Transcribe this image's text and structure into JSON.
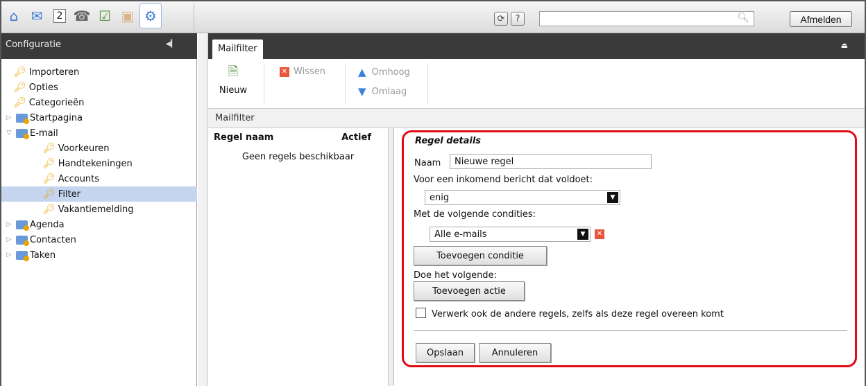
{
  "topbar": {
    "apps": [
      {
        "icon": "home-icon",
        "glyph": "⌂"
      },
      {
        "icon": "mail-icon",
        "glyph": "✉"
      },
      {
        "icon": "calendar-icon",
        "glyph": "2"
      },
      {
        "icon": "contacts-icon",
        "glyph": "☎"
      },
      {
        "icon": "tasks-icon",
        "glyph": "☑"
      },
      {
        "icon": "briefcase-icon",
        "glyph": "▣"
      },
      {
        "icon": "settings-icon",
        "glyph": "⚙"
      }
    ],
    "refresh_glyph": "⟳",
    "help_glyph": "?",
    "search": {
      "placeholder": "",
      "value": ""
    },
    "logout_label": "Afmelden"
  },
  "left": {
    "title": "Configuratie",
    "tree": [
      {
        "label": "Importeren",
        "type": "key",
        "level": 0
      },
      {
        "label": "Opties",
        "type": "key",
        "level": 0
      },
      {
        "label": "Categorieën",
        "type": "key",
        "level": 0
      },
      {
        "label": "Startpagina",
        "type": "folder",
        "level": 0,
        "twist": "▷"
      },
      {
        "label": "E-mail",
        "type": "folder",
        "level": 0,
        "twist": "▽"
      },
      {
        "label": "Voorkeuren",
        "type": "key",
        "level": 1
      },
      {
        "label": "Handtekeningen",
        "type": "key",
        "level": 1
      },
      {
        "label": "Accounts",
        "type": "key",
        "level": 1
      },
      {
        "label": "Filter",
        "type": "key",
        "level": 1,
        "selected": true
      },
      {
        "label": "Vakantiemelding",
        "type": "key",
        "level": 1
      },
      {
        "label": "Agenda",
        "type": "folder",
        "level": 0,
        "twist": "▷"
      },
      {
        "label": "Contacten",
        "type": "folder",
        "level": 0,
        "twist": "▷"
      },
      {
        "label": "Taken",
        "type": "folder",
        "level": 0,
        "twist": "▷"
      }
    ]
  },
  "main": {
    "tab_label": "Mailfilter",
    "toolbar": {
      "new_label": "Nieuw",
      "delete_label": "Wissen",
      "up_label": "Omhoog",
      "down_label": "Omlaag"
    },
    "breadcrumb": "Mailfilter",
    "list": {
      "col_name": "Regel naam",
      "col_active": "Actief",
      "empty": "Geen regels beschikbaar"
    },
    "details": {
      "title": "Regel details",
      "name_label": "Naam",
      "name_value": "Nieuwe regel",
      "match_label": "Voor een inkomend bericht dat voldoet:",
      "match_value": "enig",
      "conditions_label": "Met de volgende condities:",
      "condition_value": "Alle e-mails",
      "add_condition_label": "Toevoegen conditie",
      "actions_label": "Doe het volgende:",
      "add_action_label": "Toevoegen actie",
      "continue_label": "Verwerk ook de andere regels, zelfs als deze regel overeen komt",
      "save_label": "Opslaan",
      "cancel_label": "Annuleren"
    }
  },
  "colors": {
    "highlight": "#e30a14",
    "dark_header": "#3a3a3a",
    "selection": "#c5d5ef"
  }
}
